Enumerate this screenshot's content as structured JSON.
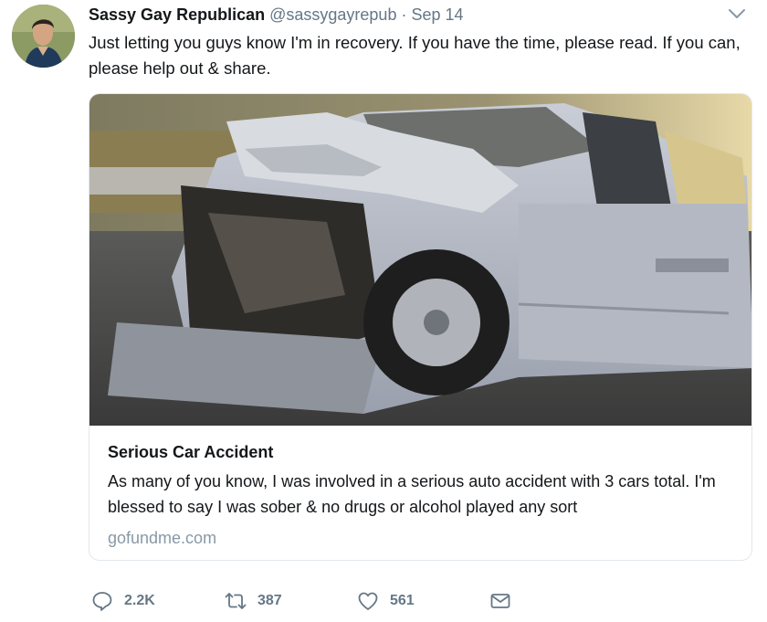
{
  "tweet": {
    "display_name": "Sassy Gay Republican",
    "handle": "@sassygayrepub",
    "separator": "·",
    "date": "Sep 14",
    "text": "Just letting you guys know I'm in recovery. If you have the time, please read. If you can, please help out & share."
  },
  "card": {
    "title": "Serious Car Accident",
    "description": "As many of you know, I was involved in a serious auto accident with 3 cars total. I'm blessed to say I was sober & no drugs or alcohol played any sort",
    "domain": "gofundme.com"
  },
  "actions": {
    "reply_count": "2.2K",
    "retweet_count": "387",
    "like_count": "561"
  },
  "colors": {
    "text": "#14171a",
    "secondary": "#657786",
    "domain": "#8899a6",
    "border": "#e1e8ed"
  },
  "icons": [
    "chevron-down-icon",
    "reply-icon",
    "retweet-icon",
    "like-icon",
    "direct-message-icon"
  ]
}
